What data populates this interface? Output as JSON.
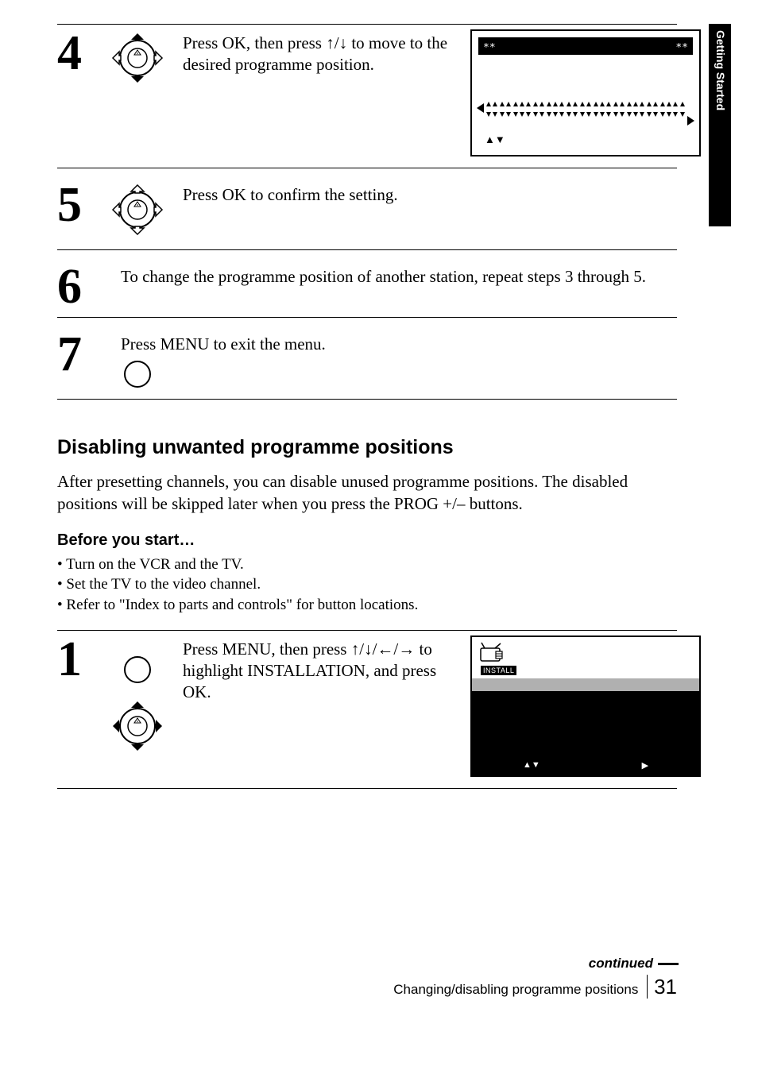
{
  "side_tab": "Getting Started",
  "steps": {
    "s4": {
      "num": "4",
      "text_parts": [
        "Press OK, then press ",
        "/",
        " to move to the desired programme position."
      ],
      "display": {
        "left_stars": "∗∗",
        "right_stars": "∗∗",
        "nav": "▲▼"
      }
    },
    "s5": {
      "num": "5",
      "text": "Press OK to confirm the setting."
    },
    "s6": {
      "num": "6",
      "text": "To change the programme position of another station, repeat steps 3 through 5."
    },
    "s7": {
      "num": "7",
      "text": "Press MENU to exit the menu."
    }
  },
  "section_heading": "Disabling unwanted programme positions",
  "section_body": "After presetting channels, you can disable unused programme positions.  The disabled positions will be skipped later when you press the PROG +/– buttons.",
  "before_heading": "Before you start…",
  "before_bullets": [
    "Turn on the VCR and the TV.",
    "Set the TV to the video channel.",
    "Refer to \"Index to parts and controls\" for button locations."
  ],
  "disable_step1": {
    "num": "1",
    "text_parts": [
      "Press MENU, then press ",
      "/",
      "/",
      "/",
      " to highlight INSTALLATION, and press OK."
    ],
    "menu_label": "INSTALL",
    "menu_nav_left": "▲▼",
    "menu_nav_right": "▶"
  },
  "footer": {
    "continued": "continued",
    "title": "Changing/disabling programme positions",
    "page": "31"
  }
}
